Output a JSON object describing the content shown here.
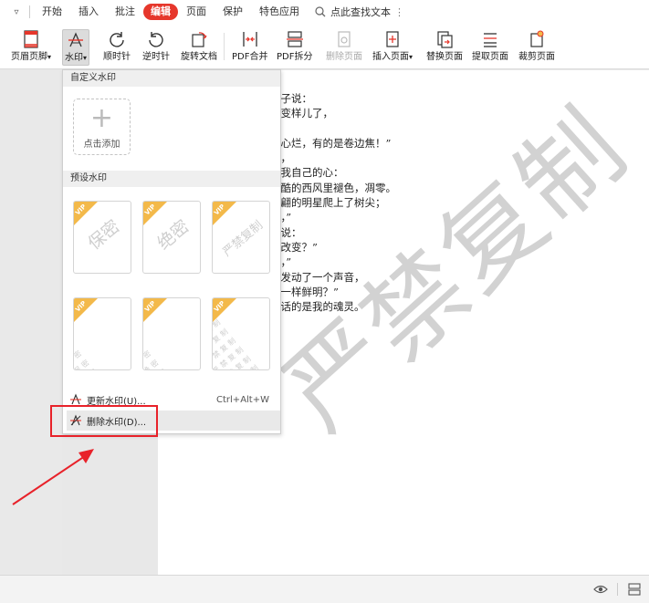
{
  "menubar": {
    "items": [
      "开始",
      "插入",
      "批注",
      "编辑",
      "页面",
      "保护",
      "特色应用"
    ],
    "active_index": 3,
    "search_label": "点此查找文本"
  },
  "ribbon": {
    "tools": [
      {
        "label": "页眉页脚",
        "caret": "▾"
      },
      {
        "label": "水印",
        "caret": "▾"
      },
      {
        "label": "顺时针"
      },
      {
        "label": "逆时针"
      },
      {
        "label": "旋转文档"
      },
      {
        "label": "PDF合并"
      },
      {
        "label": "PDF拆分"
      },
      {
        "label": "删除页面"
      },
      {
        "label": "插入页面",
        "caret": "▾"
      },
      {
        "label": "替换页面"
      },
      {
        "label": "提取页面"
      },
      {
        "label": "裁剪页面"
      }
    ]
  },
  "panel": {
    "custom_header": "自定义水印",
    "add_label": "点击添加",
    "preset_header": "预设水印",
    "vip_badge": "VIP",
    "presets": [
      "保密",
      "绝密",
      "严禁复制",
      "保密",
      "绝密",
      "严禁复制"
    ],
    "menu": {
      "update_label": "更新水印(U)...",
      "update_shortcut": "Ctrl+Alt+W",
      "delete_label": "删除水印(D)..."
    }
  },
  "document": {
    "lines": [
      "叶子说：",
      "又变样儿了，",
      "",
      "油心烂，有的是卷边焦！”",
      "已，",
      "是我自己的心：",
      "冷酷的西风里褪色，凋零。",
      "走翩的明星爬上了树尖；",
      "儿，”",
      "佛说：",
      "有改变？”",
      "儿，”",
      "又发动了一个声音，",
      "是一样鲜明？”",
      "香话的是我的魂灵。"
    ],
    "watermark": "严禁复制"
  },
  "colors": {
    "accent": "#e6372c",
    "highlight": "#e8222a",
    "vip": "#f3b94a"
  }
}
